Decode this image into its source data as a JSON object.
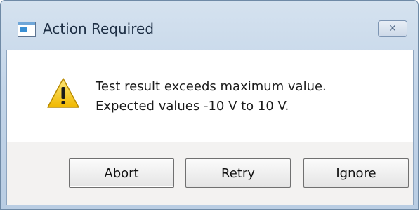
{
  "window": {
    "title": "Action Required",
    "close_glyph": "✕",
    "app_icon": "window-icon"
  },
  "message": {
    "icon": "warning-icon",
    "line1": "Test result exceeds maximum value.",
    "line2": "Expected values -10 V to 10 V."
  },
  "buttons": {
    "abort": "Abort",
    "retry": "Retry",
    "ignore": "Ignore"
  },
  "colors": {
    "titlebar": "#c2d4e8",
    "warning_fill": "#f7c800",
    "button_area": "#f3f2f1"
  }
}
